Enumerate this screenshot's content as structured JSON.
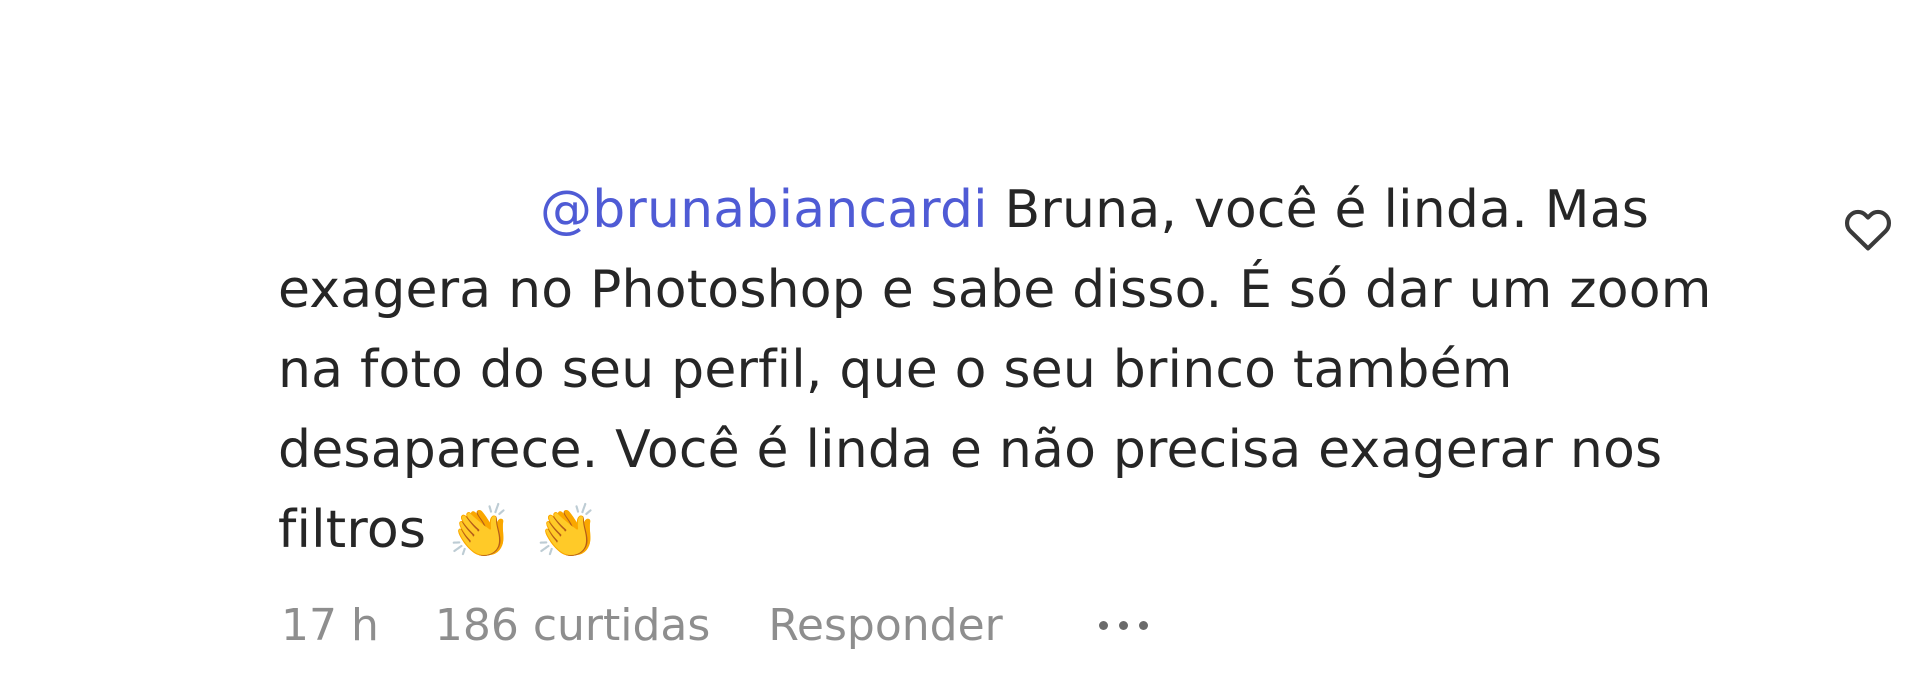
{
  "comment": {
    "mention": "@brunabiancardi",
    "text": " Bruna, você é linda. Mas exagera no Photoshop e sabe disso. É só dar um zoom na foto do seu perfil, que o seu brinco também desaparece. Você é linda e não precisa exagerar nos filtros",
    "emoji_1": "👏",
    "emoji_2": "👏",
    "emoji_names": [
      "clapping-hands-emoji",
      "clapping-hands-emoji"
    ]
  },
  "meta": {
    "time": "17 h",
    "likes": "186 curtidas",
    "reply_label": "Responder"
  },
  "icons": {
    "like": "heart-outline-icon",
    "more": "more-options-icon"
  },
  "colors": {
    "mention": "#4f5bd5",
    "text": "#262626",
    "meta": "#8e8e8e"
  }
}
